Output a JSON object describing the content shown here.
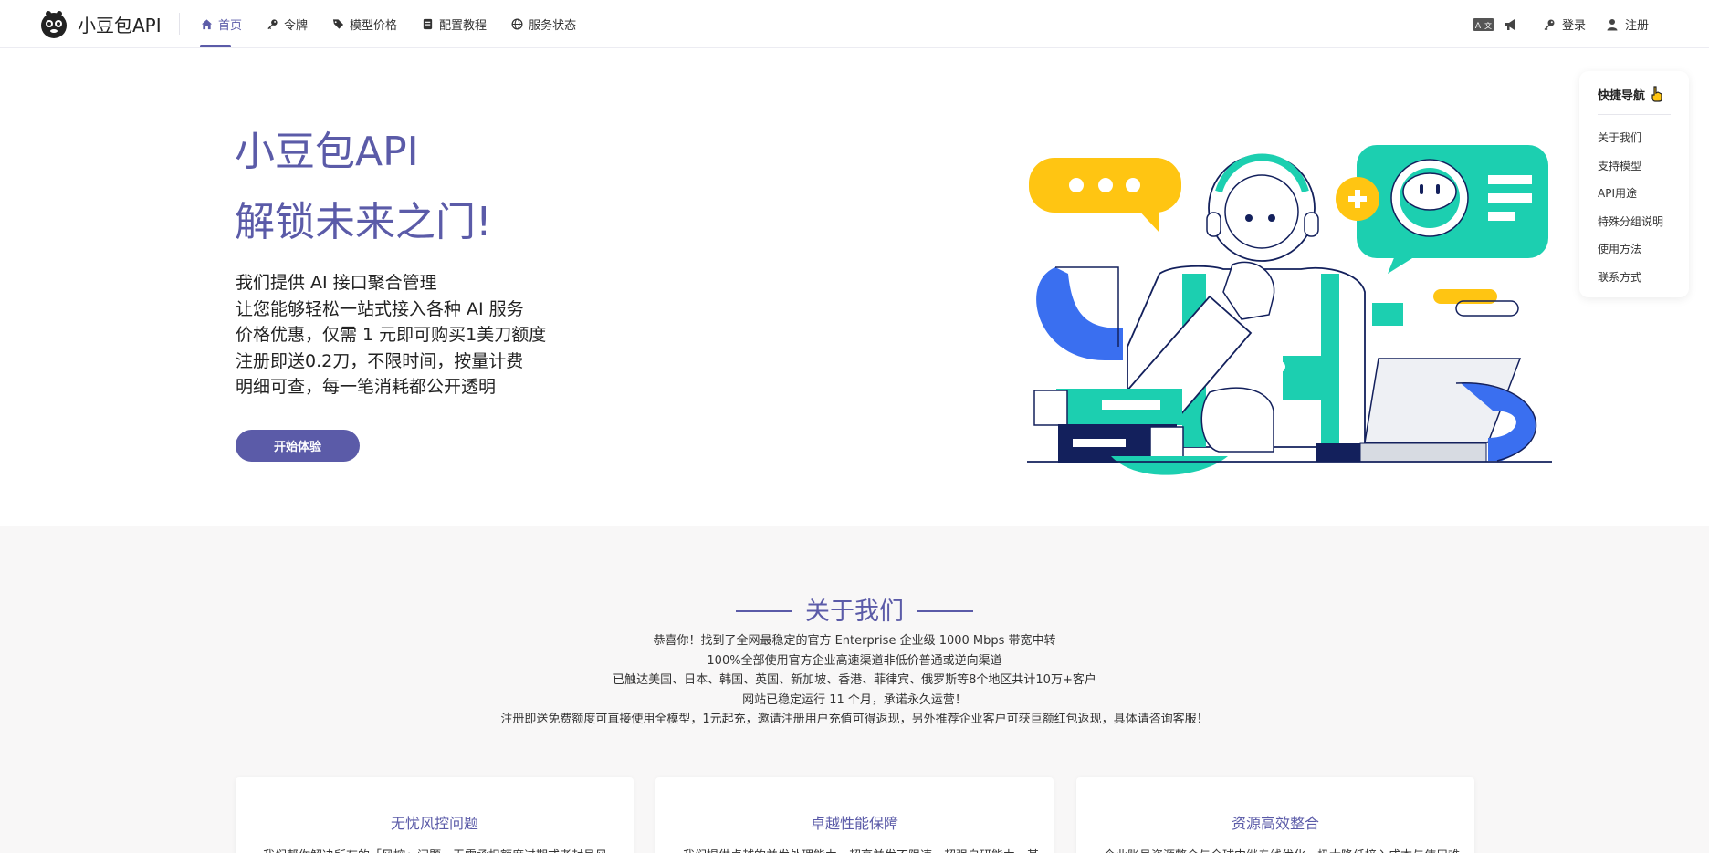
{
  "brand": {
    "name": "小豆包API"
  },
  "nav": {
    "items": [
      {
        "label": "首页",
        "icon": "home-icon",
        "active": true
      },
      {
        "label": "令牌",
        "icon": "key-icon",
        "active": false
      },
      {
        "label": "模型价格",
        "icon": "price-tag-icon",
        "active": false
      },
      {
        "label": "配置教程",
        "icon": "book-icon",
        "active": false
      },
      {
        "label": "服务状态",
        "icon": "globe-icon",
        "active": false
      }
    ],
    "right": {
      "translate_icon": "translate-icon",
      "announce_icon": "megaphone-icon",
      "login_label": "登录",
      "register_label": "注册"
    }
  },
  "hero": {
    "title": "小豆包API",
    "subtitle": "解锁未来之门!",
    "lines": [
      "我们提供 AI 接口聚合管理",
      "让您能够轻松一站式接入各种 AI 服务",
      "价格优惠，仅需 1 元即可购买1美刀额度",
      "注册即送0.2刀，不限时间，按量计费",
      "明细可查，每一笔消耗都公开透明"
    ],
    "cta_label": "开始体验"
  },
  "quicknav": {
    "title": "快捷导航",
    "items": [
      "关于我们",
      "支持模型",
      "API用途",
      "特殊分组说明",
      "使用方法",
      "联系方式"
    ]
  },
  "about": {
    "heading": "关于我们",
    "lines": [
      "恭喜你！找到了全网最稳定的官方 Enterprise 企业级 1000 Mbps 带宽中转",
      "100%全部使用官方企业高速渠道非低价普通或逆向渠道",
      "已触达美国、日本、韩国、英国、新加坡、香港、菲律宾、俄罗斯等8个地区共计10万+客户",
      "网站已稳定运行 11 个月，承诺永久运营！",
      "注册即送免费额度可直接使用全模型，1元起充，邀请注册用户充值可得返现，另外推荐企业客户可获巨额红包返现，具体请咨询客服！"
    ],
    "cards": [
      {
        "title": "无忧风控问题",
        "text": "我们帮你解决所有的「风控」问题，无需承担额度过期或者封号风"
      },
      {
        "title": "卓越性能保障",
        "text": "我们提供卓越的并发处理能力，超高并发不限速，超强自研能力，甚"
      },
      {
        "title": "资源高效整合",
        "text": "企业账号资源整合与全球中继专线优化，极大降低接入成本与使用难"
      }
    ]
  },
  "colors": {
    "accent": "#5b5ba8",
    "teal": "#1ccfb0",
    "yellow": "#ffc512",
    "blue": "#3a6ff0",
    "navy": "#13205c"
  }
}
